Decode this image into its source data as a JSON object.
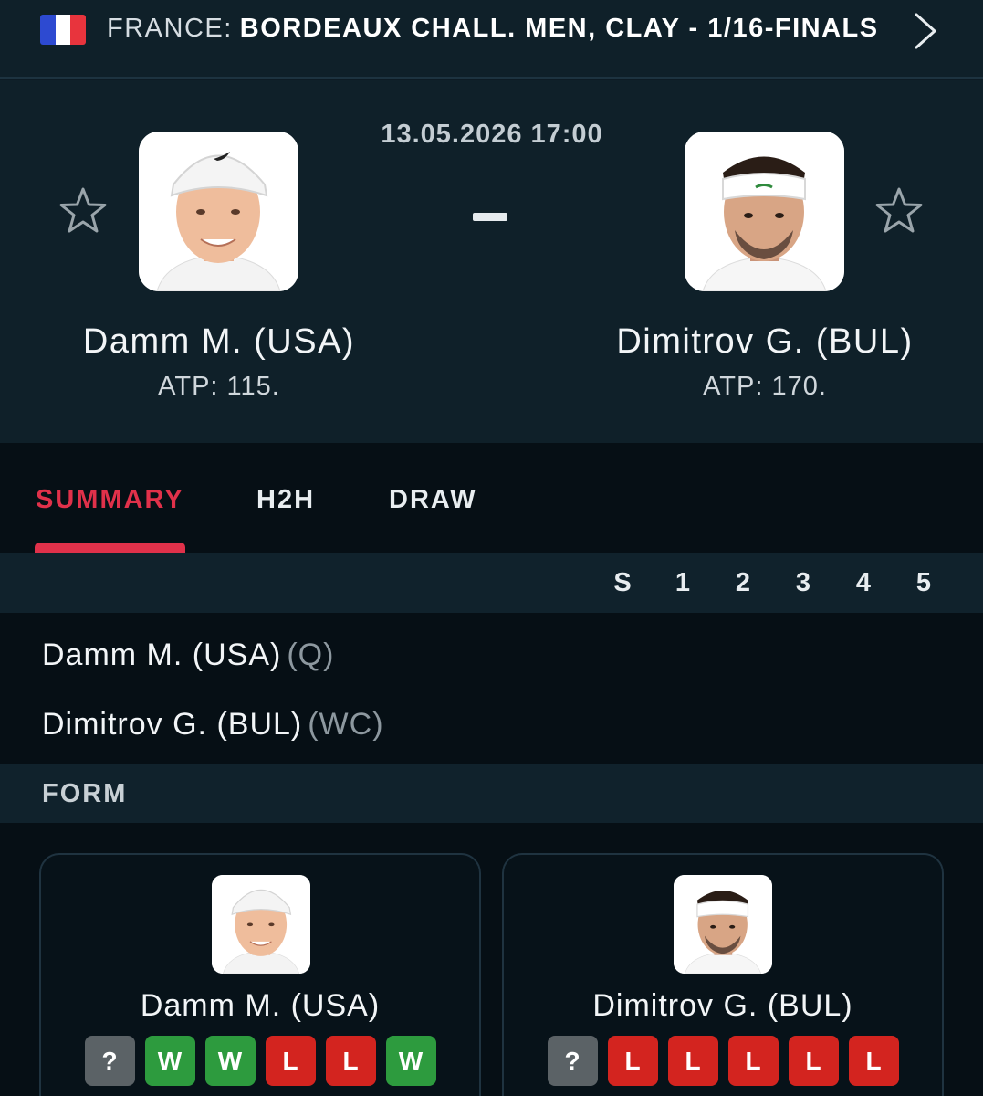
{
  "breadcrumb": {
    "country": "FRANCE:",
    "tournament": "BORDEAUX CHALL. MEN, CLAY - 1/16-FINALS"
  },
  "colors": {
    "accent": "#e0314a",
    "win": "#2d9b3e",
    "loss": "#d3241f",
    "unknown": "#5b6266"
  },
  "match": {
    "datetime": "13.05.2026 17:00",
    "score": "-"
  },
  "home": {
    "name": "Damm M. (USA)",
    "rank": "ATP: 115.",
    "tag": "(Q)"
  },
  "away": {
    "name": "Dimitrov G. (BUL)",
    "rank": "ATP: 170.",
    "tag": "(WC)"
  },
  "tabs": [
    {
      "label": "SUMMARY",
      "active": true
    },
    {
      "label": "H2H",
      "active": false
    },
    {
      "label": "DRAW",
      "active": false
    }
  ],
  "sets": [
    "S",
    "1",
    "2",
    "3",
    "4",
    "5"
  ],
  "form": {
    "title": "FORM",
    "home_results": [
      "?",
      "W",
      "W",
      "L",
      "L",
      "W"
    ],
    "away_results": [
      "?",
      "L",
      "L",
      "L",
      "L",
      "L"
    ]
  },
  "icons": {
    "back": "chevron-right-icon",
    "favorite": "star-outline-icon"
  }
}
